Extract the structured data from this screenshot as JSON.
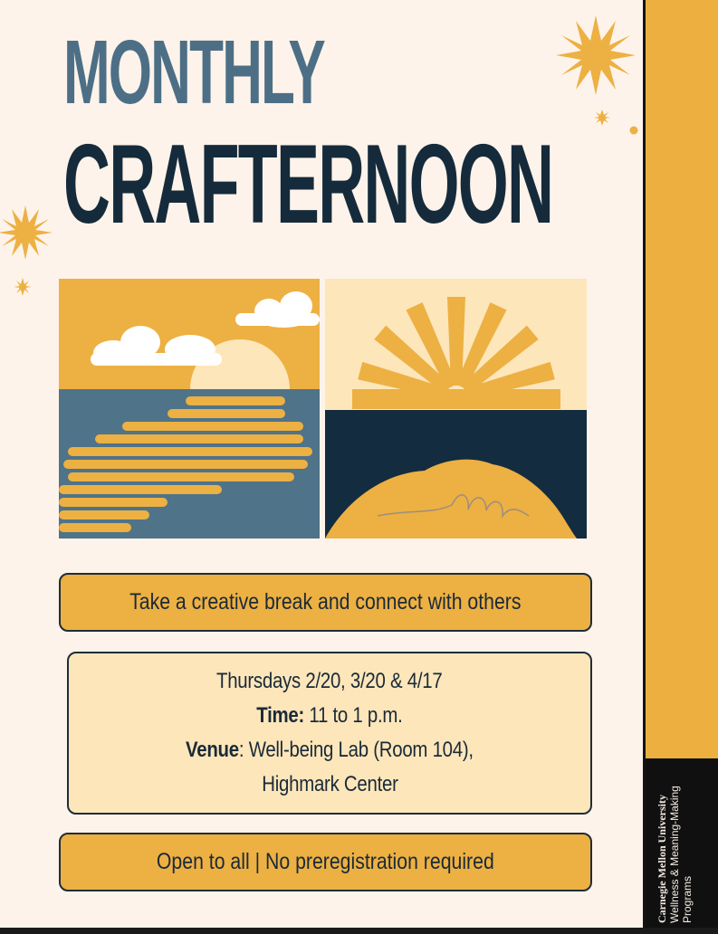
{
  "title": {
    "line1": "MONTHLY",
    "line2": "CRAFTERNOON"
  },
  "tagline": "Take a creative break and connect with others",
  "details": {
    "dates": "Thursdays  2/20, 3/20 & 4/17",
    "time_label": "Time:",
    "time_value": " 11 to 1 p.m.",
    "venue_label": "Venue",
    "venue_value": ": Well-being Lab (Room 104),",
    "venue_line2": "Highmark Center"
  },
  "footer_note": "Open to all | No preregistration required",
  "sidebar": {
    "university": "Carnegie Mellon University",
    "department_line1": "Wellness & Meaning-Making",
    "department_line2": "Programs"
  },
  "colors": {
    "background": "#fdf3ea",
    "gold": "#edb042",
    "light_gold": "#fde6ba",
    "navy": "#152b3b",
    "slate_blue": "#4d6f86"
  },
  "icons": [
    "sun-burst-icon",
    "ocean-sunset-illustration",
    "sunrise-illustration"
  ]
}
